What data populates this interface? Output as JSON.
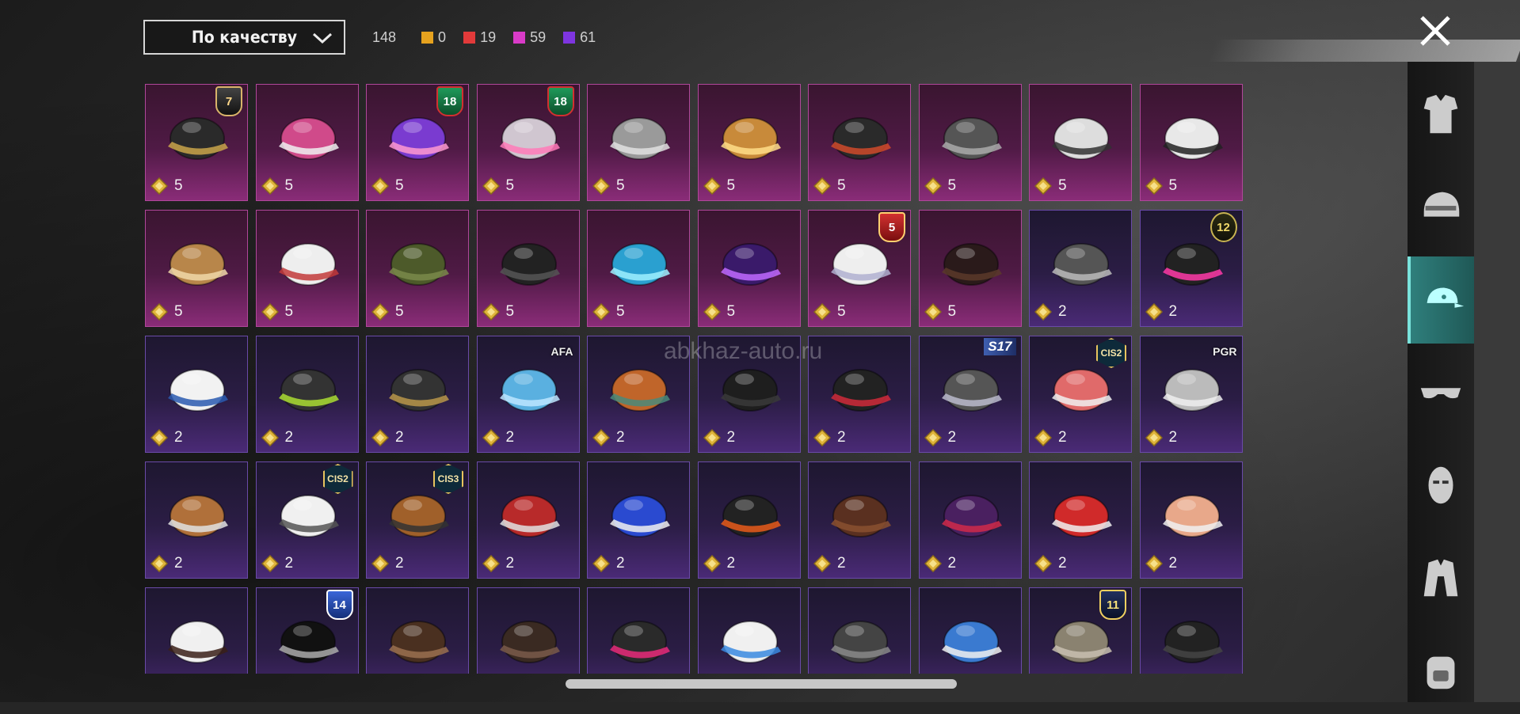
{
  "sort": {
    "label": "По качеству"
  },
  "counts": {
    "total": "148",
    "items": [
      {
        "value": "0",
        "color": "#e6a21e"
      },
      {
        "value": "19",
        "color": "#e23a3a"
      },
      {
        "value": "59",
        "color": "#d93bc8"
      },
      {
        "value": "61",
        "color": "#7e35e0"
      }
    ]
  },
  "watermark": "abkhaz-auto.ru",
  "categories": [
    {
      "name": "outfit-icon",
      "active": false
    },
    {
      "name": "helmet-icon",
      "active": false
    },
    {
      "name": "cap-icon",
      "active": true
    },
    {
      "name": "glasses-icon",
      "active": false
    },
    {
      "name": "face-mask-icon",
      "active": false
    },
    {
      "name": "jacket-icon",
      "active": false
    },
    {
      "name": "backpack-icon",
      "active": false
    }
  ],
  "items": [
    {
      "rarity": "pink",
      "cost": "5",
      "badge": "7",
      "badge_style": "shield",
      "art": "officer-cap"
    },
    {
      "rarity": "pink",
      "cost": "5",
      "art": "cat-mask"
    },
    {
      "rarity": "pink",
      "cost": "5",
      "badge": "18",
      "badge_style": "shield green",
      "art": "spiked-helmet-purple"
    },
    {
      "rarity": "pink",
      "cost": "5",
      "badge": "18",
      "badge_style": "shield green",
      "art": "spiked-helmet-white"
    },
    {
      "rarity": "pink",
      "cost": "5",
      "art": "dreadlock-mask"
    },
    {
      "rarity": "pink",
      "cost": "5",
      "art": "camel-mask"
    },
    {
      "rarity": "pink",
      "cost": "5",
      "art": "bandana"
    },
    {
      "rarity": "pink",
      "cost": "5",
      "art": "wolf-mask"
    },
    {
      "rarity": "pink",
      "cost": "5",
      "art": "rabbit-mask"
    },
    {
      "rarity": "pink",
      "cost": "5",
      "art": "zebra-mask"
    },
    {
      "rarity": "pink",
      "cost": "5",
      "art": "antelope-mask"
    },
    {
      "rarity": "pink",
      "cost": "5",
      "art": "camera-headset"
    },
    {
      "rarity": "pink",
      "cost": "5",
      "art": "military-helmet"
    },
    {
      "rarity": "pink",
      "cost": "5",
      "art": "visor-helmet"
    },
    {
      "rarity": "pink",
      "cost": "5",
      "art": "fish-mask"
    },
    {
      "rarity": "pink",
      "cost": "5",
      "art": "purple-helmet"
    },
    {
      "rarity": "pink",
      "cost": "5",
      "badge": "5",
      "badge_style": "shield red",
      "art": "white-hat"
    },
    {
      "rarity": "pink",
      "cost": "5",
      "art": "headband"
    },
    {
      "rarity": "purple",
      "cost": "2",
      "art": "grey-hair"
    },
    {
      "rarity": "purple",
      "cost": "2",
      "badge": "12",
      "badge_style": "shield olive",
      "art": "bunny-helmet"
    },
    {
      "rarity": "purple",
      "cost": "2",
      "art": "blue-cap"
    },
    {
      "rarity": "purple",
      "cost": "2",
      "art": "gas-mask-helmet"
    },
    {
      "rarity": "purple",
      "cost": "2",
      "art": "dark-helmet"
    },
    {
      "rarity": "purple",
      "cost": "2",
      "badge": "AFA",
      "badge_style": "plain",
      "art": "light-blue-cap"
    },
    {
      "rarity": "purple",
      "cost": "2",
      "art": "brown-hair-cap"
    },
    {
      "rarity": "purple",
      "cost": "2",
      "art": "black-cap"
    },
    {
      "rarity": "purple",
      "cost": "2",
      "art": "bucket-hat-red-hair"
    },
    {
      "rarity": "purple",
      "cost": "2",
      "badge": "S17",
      "badge_style": "s17",
      "art": "horned-helmet"
    },
    {
      "rarity": "purple",
      "cost": "2",
      "badge": "CIS2",
      "badge_style": "hex",
      "art": "striped-bandana"
    },
    {
      "rarity": "purple",
      "cost": "2",
      "badge": "PGR",
      "badge_style": "plain",
      "art": "silver-hair"
    },
    {
      "rarity": "purple",
      "cost": "2",
      "art": "braid-headband"
    },
    {
      "rarity": "purple",
      "cost": "2",
      "badge": "CIS2",
      "badge_style": "hex",
      "art": "chef-hat"
    },
    {
      "rarity": "purple",
      "cost": "2",
      "badge": "CIS3",
      "badge_style": "hex",
      "art": "brown-cap-gear"
    },
    {
      "rarity": "purple",
      "cost": "2",
      "art": "red-helmet"
    },
    {
      "rarity": "purple",
      "cost": "2",
      "art": "cricket-helmet"
    },
    {
      "rarity": "purple",
      "cost": "2",
      "art": "orange-hair-helmet"
    },
    {
      "rarity": "purple",
      "cost": "2",
      "art": "brown-hair"
    },
    {
      "rarity": "purple",
      "cost": "2",
      "art": "purple-top-hat"
    },
    {
      "rarity": "purple",
      "cost": "2",
      "art": "red-white-cap"
    },
    {
      "rarity": "purple",
      "cost": "2",
      "art": "knit-beanie"
    },
    {
      "rarity": "purple",
      "cost": "2",
      "art": "geisha-mask"
    },
    {
      "rarity": "purple",
      "cost": "2",
      "badge": "14",
      "badge_style": "shield blue",
      "art": "police-cap"
    },
    {
      "rarity": "purple",
      "cost": "2",
      "art": "goggle-hat"
    },
    {
      "rarity": "purple",
      "cost": "2",
      "art": "brown-fedora"
    },
    {
      "rarity": "purple",
      "cost": "2",
      "art": "pink-cap"
    },
    {
      "rarity": "purple",
      "cost": "2",
      "art": "bunny-ears"
    },
    {
      "rarity": "purple",
      "cost": "2",
      "art": "ski-hood"
    },
    {
      "rarity": "purple",
      "cost": "2",
      "art": "blue-beanie"
    },
    {
      "rarity": "purple",
      "cost": "2",
      "badge": "11",
      "badge_style": "shield navy",
      "art": "bucket-hat"
    },
    {
      "rarity": "purple",
      "cost": "2",
      "art": "black-baseball-cap"
    }
  ]
}
